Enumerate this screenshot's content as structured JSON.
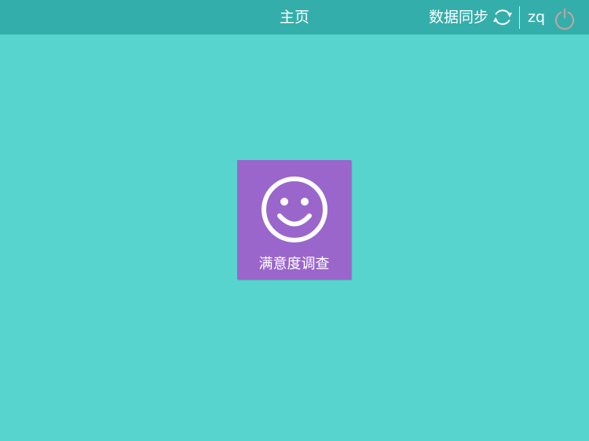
{
  "header": {
    "title": "主页",
    "sync_label": "数据同步",
    "sync_icon": "sync-icon",
    "username": "zq",
    "logout_icon": "power-icon"
  },
  "main": {
    "tiles": [
      {
        "label": "满意度调查",
        "icon": "smiley-icon",
        "color": "#9a66cb"
      }
    ]
  },
  "colors": {
    "background": "#57d4cd",
    "header": "#34aeaa",
    "text": "#ffffff",
    "power_icon": "#b9a7a1"
  }
}
